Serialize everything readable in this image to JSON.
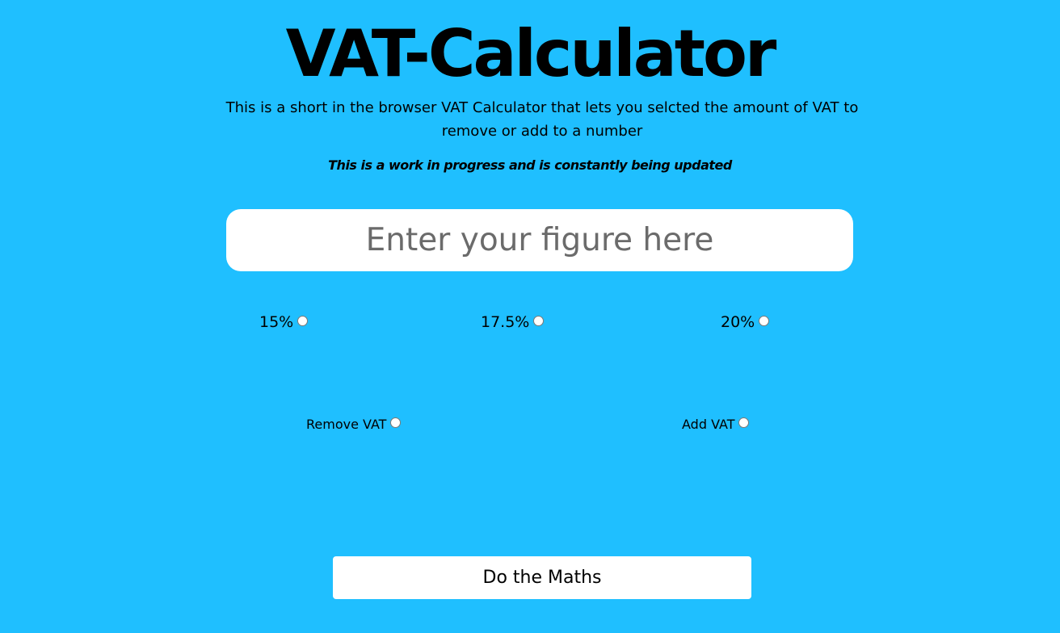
{
  "header": {
    "title": "VAT-Calculator",
    "description": "This is a short in the browser VAT Calculator that lets you selcted the amount of VAT to remove or add to a number",
    "note": "This is a work in progress and is constantly being updated"
  },
  "figure_input": {
    "value": "",
    "placeholder": "Enter your figure here"
  },
  "vat_rates": [
    {
      "label": "15%",
      "checked": false
    },
    {
      "label": "17.5%",
      "checked": false
    },
    {
      "label": "20%",
      "checked": false
    }
  ],
  "modes": [
    {
      "label": "Remove VAT",
      "checked": false
    },
    {
      "label": "Add VAT",
      "checked": false
    }
  ],
  "actions": {
    "calculate_label": "Do the Maths"
  },
  "colors": {
    "background": "#1fbfff",
    "surface": "#ffffff",
    "text": "#000000",
    "placeholder": "#6b6b6b"
  }
}
